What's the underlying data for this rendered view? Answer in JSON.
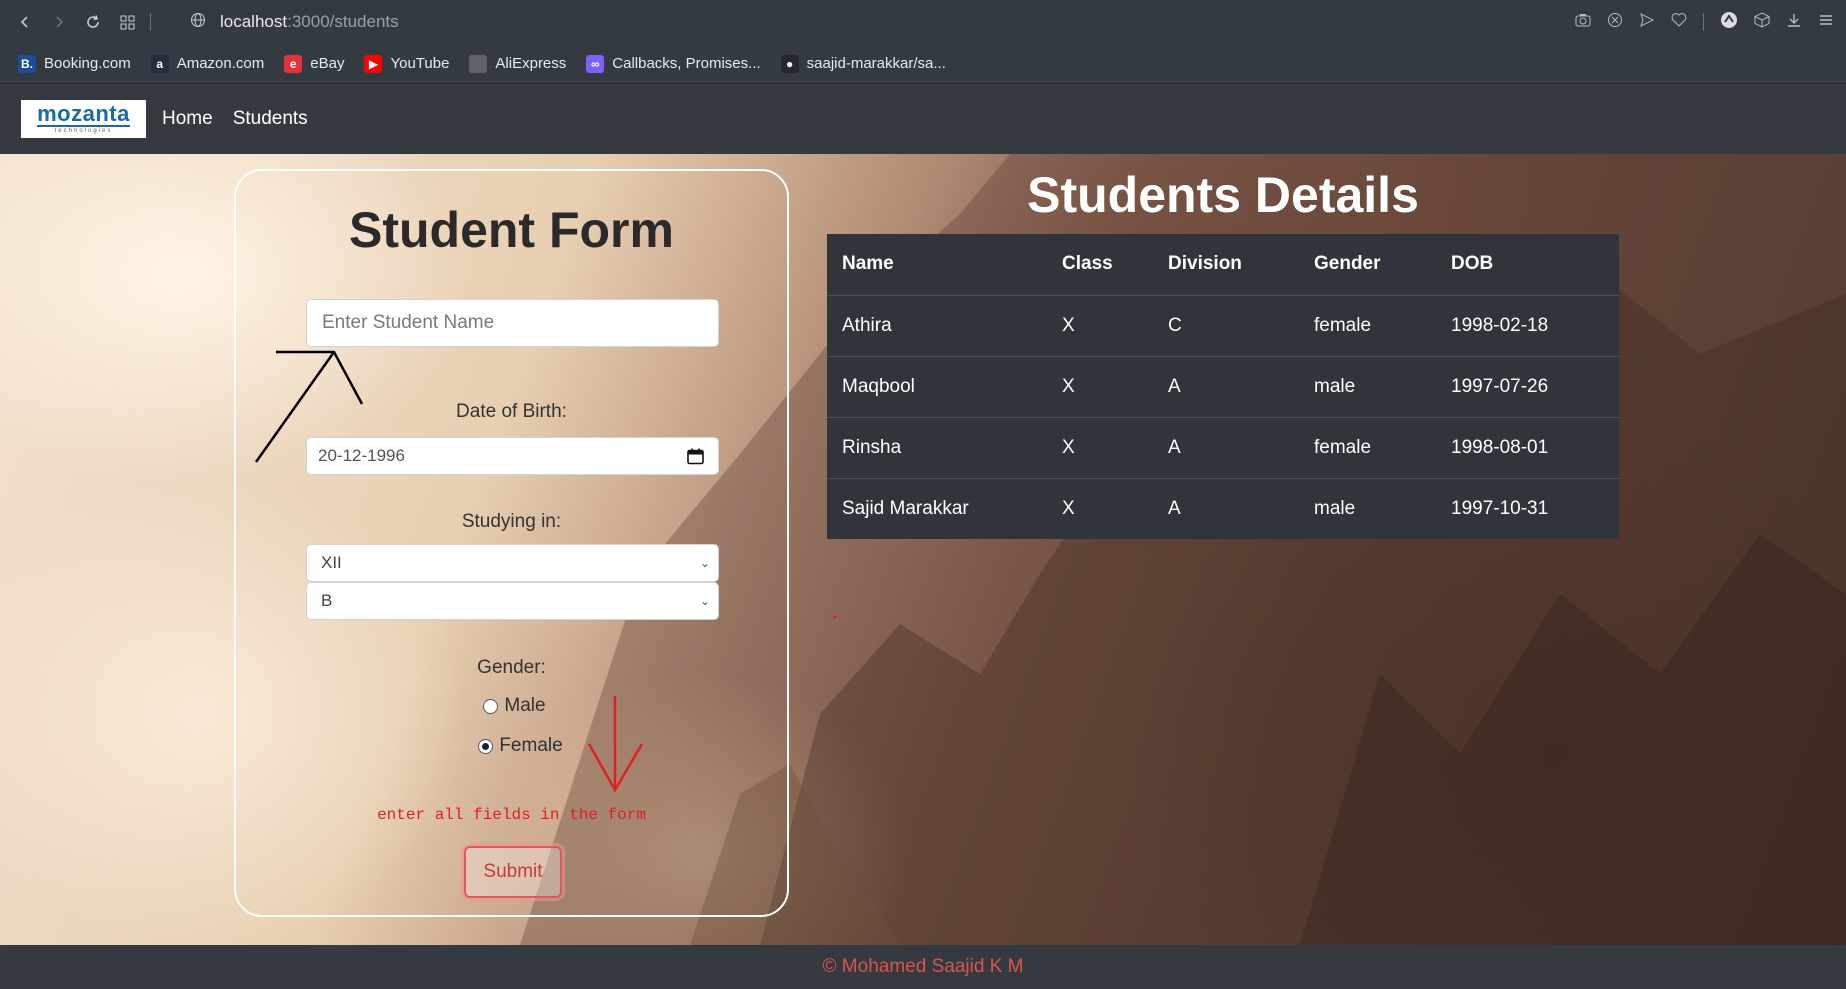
{
  "browser": {
    "host": "localhost",
    "path": ":3000/students",
    "bookmarks": [
      {
        "label": "Booking.com",
        "icon": "booking-icon",
        "color": "#1f4a9a",
        "glyph": "B."
      },
      {
        "label": "Amazon.com",
        "icon": "amazon-icon",
        "color": "#232f3e",
        "glyph": "a"
      },
      {
        "label": "eBay",
        "icon": "ebay-icon",
        "color": "#e53238",
        "glyph": "e"
      },
      {
        "label": "YouTube",
        "icon": "youtube-icon",
        "color": "#ff0000",
        "glyph": "▶"
      },
      {
        "label": "AliExpress",
        "icon": "file-icon",
        "color": "#5f6368",
        "glyph": ""
      },
      {
        "label": "Callbacks, Promises...",
        "icon": "callbacks-icon",
        "color": "#7b61ff",
        "glyph": "∞"
      },
      {
        "label": "saajid-marakkar/sa...",
        "icon": "github-icon",
        "color": "#24292e",
        "glyph": "●"
      }
    ]
  },
  "navbar": {
    "logo_text": "mozanta",
    "logo_sub": "technologies",
    "links": [
      "Home",
      "Students"
    ]
  },
  "form": {
    "title": "Student Form",
    "name_placeholder": "Enter Student Name",
    "dob_label": "Date of Birth:",
    "dob_value": "20-12-1996",
    "studying_label": "Studying in:",
    "class_value": "XII",
    "division_value": "B",
    "gender_label": "Gender:",
    "gender_options": [
      "Male",
      "Female"
    ],
    "gender_selected": "Female",
    "error_text": "enter all fields in the form",
    "submit_label": "Submit"
  },
  "table": {
    "title": "Students Details",
    "headers": [
      "Name",
      "Class",
      "Division",
      "Gender",
      "DOB"
    ],
    "rows": [
      [
        "Athira",
        "X",
        "C",
        "female",
        "1998-02-18"
      ],
      [
        "Maqbool",
        "X",
        "A",
        "male",
        "1997-07-26"
      ],
      [
        "Rinsha",
        "X",
        "A",
        "female",
        "1998-08-01"
      ],
      [
        "Sajid Marakkar",
        "X",
        "A",
        "male",
        "1997-10-31"
      ]
    ]
  },
  "footer": {
    "text": "© Mohamed Saajid K M"
  },
  "colors": {
    "error": "#e02020",
    "footer_text": "#d9534f",
    "navbar": "#343a40"
  }
}
